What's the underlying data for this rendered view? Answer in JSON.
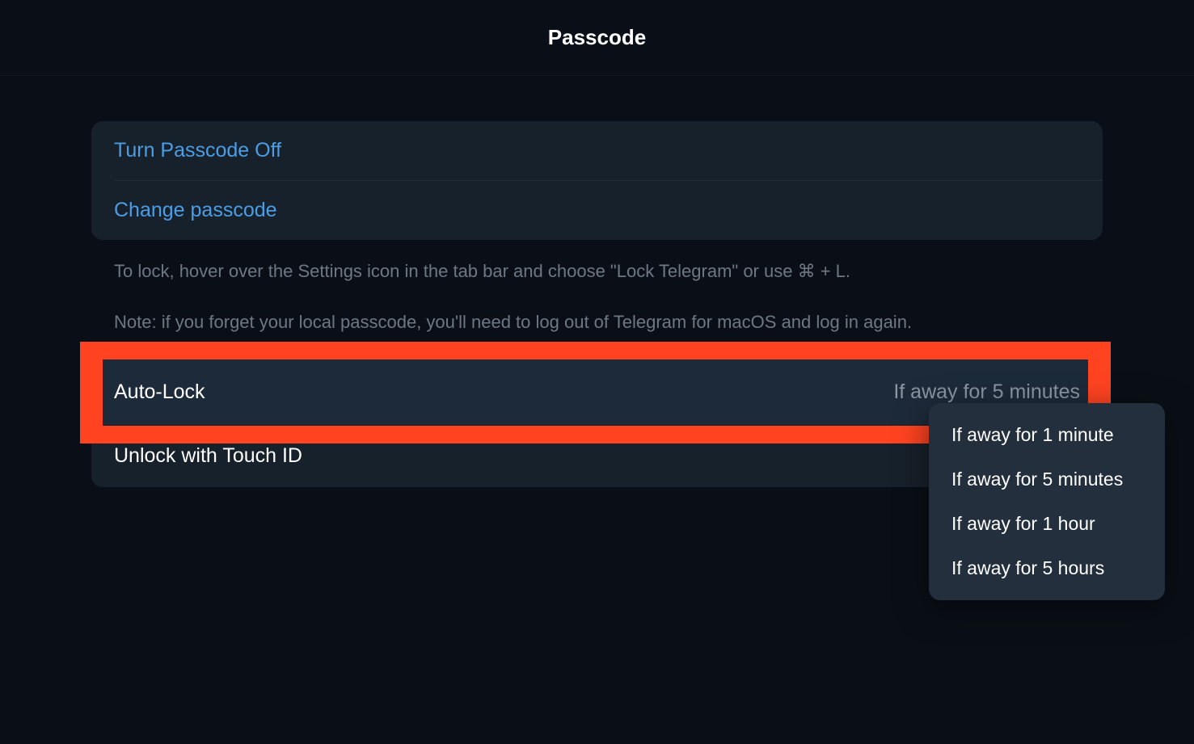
{
  "header": {
    "title": "Passcode"
  },
  "group1": {
    "turnOff": "Turn Passcode Off",
    "change": "Change passcode"
  },
  "help": {
    "line1": "To lock, hover over the Settings icon in the tab bar and choose \"Lock Telegram\" or use ⌘ + L.",
    "line2": "Note: if you forget your local passcode, you'll need to log out of Telegram for macOS and log in again."
  },
  "autolock": {
    "label": "Auto-Lock",
    "value": "If away for 5 minutes"
  },
  "touchid": {
    "label": "Unlock with Touch ID"
  },
  "dropdown": {
    "options": [
      "If away for 1 minute",
      "If away for 5 minutes",
      "If away for 1 hour",
      "If away for 5 hours"
    ]
  }
}
